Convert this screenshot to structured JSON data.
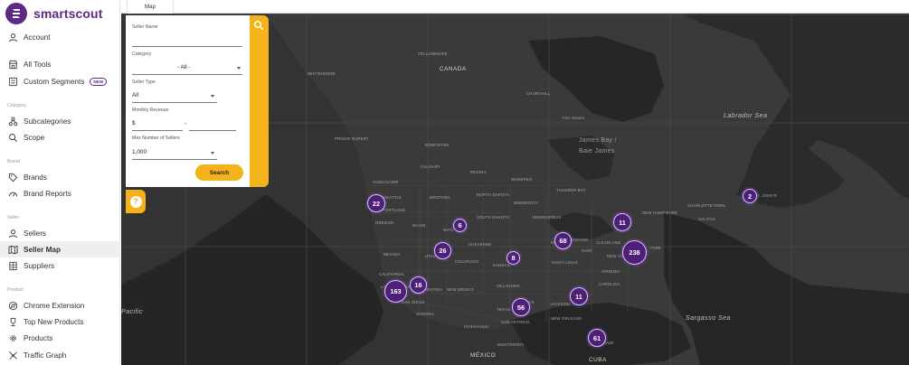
{
  "app": {
    "name": "smartscout",
    "brand_color": "#5b2a86",
    "accent_color": "#f4b21b"
  },
  "sidebar": {
    "account": {
      "label": "Account",
      "icon": "user-icon"
    },
    "all_tools": {
      "label": "All Tools",
      "icon": "store-icon"
    },
    "custom_segments": {
      "label": "Custom Segments",
      "badge": "NEW",
      "icon": "segments-icon"
    },
    "category_section": "Category",
    "subcategories": {
      "label": "Subcategories",
      "icon": "subcategories-icon"
    },
    "scope": {
      "label": "Scope",
      "icon": "scope-icon"
    },
    "brand_section": "Brand",
    "brands": {
      "label": "Brands",
      "icon": "tag-icon"
    },
    "brand_reports": {
      "label": "Brand Reports",
      "icon": "gauge-icon"
    },
    "seller_section": "Seller",
    "sellers": {
      "label": "Sellers",
      "icon": "user-icon"
    },
    "seller_map": {
      "label": "Seller Map",
      "icon": "map-icon",
      "active": true
    },
    "suppliers": {
      "label": "Suppliers",
      "icon": "building-icon"
    },
    "product_section": "Product",
    "chrome_extension": {
      "label": "Chrome Extension",
      "icon": "chrome-icon"
    },
    "top_new_products": {
      "label": "Top New Products",
      "icon": "trophy-icon"
    },
    "products": {
      "label": "Products",
      "icon": "gear-icon"
    },
    "traffic_graph": {
      "label": "Traffic Graph",
      "icon": "network-icon"
    }
  },
  "tabs": {
    "map": "Map"
  },
  "filter": {
    "seller_name_label": "Seller Name",
    "seller_name_value": "",
    "category_label": "Category",
    "category_value": "- All -",
    "seller_type_label": "Seller Type",
    "seller_type_value": "All",
    "monthly_revenue_label": "Monthly Revenue",
    "revenue_prefix": "$",
    "revenue_separator": "-",
    "max_sellers_label": "Max Number of Sellers",
    "max_sellers_value": "1,000",
    "search_label": "Search",
    "search_icon": "search-icon",
    "help_icon": "question-icon",
    "help_text": "?"
  },
  "map": {
    "countries": {
      "canada": "CANADA",
      "mexico": "MÉXICO",
      "cuba": "CUBA"
    },
    "seas": {
      "labrador": "Labrador Sea",
      "sargasso": "Sargasso Sea",
      "pacific": "Pacific"
    },
    "regions": {
      "james_bay": "James Bay /",
      "baie_james": "Baie James"
    },
    "places": {
      "whitehorse": "WHITEHORSE",
      "yellowknife": "YELLOWKNIFE",
      "churchill": "CHURCHILL",
      "fort_severn": "Fort Severn",
      "prince_rupert": "PRINCE RUPERT",
      "edmonton": "EDMONTON",
      "calgary": "CALGARY",
      "regina": "REGINA",
      "winnipeg": "WINNIPEG",
      "vancouver": "VANCOUVER",
      "seattle": "SEATTLE",
      "portland": "PORTLAND",
      "oregon": "OREGON",
      "idaho": "IDAHO",
      "montana": "MONTANA",
      "north_dakota": "NORTH DAKOTA",
      "south_dakota": "SOUTH DAKOTA",
      "minnesota": "MINNESOTA",
      "thunder_bay": "THUNDER BAY",
      "minneapolis": "MINNEAPOLIS",
      "wyoming": "WYO",
      "cheyenne": "CHEYENNE",
      "nevada": "NEVADA",
      "utah": "UTAH",
      "colorado": "COLORADO",
      "kansas": "KANSAS",
      "chicago": "CHICAGO",
      "detroit": "DETROIT",
      "ohio": "OHIO",
      "cleveland": "CLEVELAND",
      "new_york": "NEW YORK",
      "york": "YORK",
      "new_hampshire": "NEW HAMPSHIRE",
      "charlottetown": "CHARLOTTETOWN",
      "halifax": "HALIFAX",
      "st_johns": "ST. JOHN'S",
      "california": "CALIFORNIA",
      "los_angeles": "LOS ANGELES",
      "san_diego": "SAN DIEGO",
      "arizona": "ARIZONA",
      "new_mexico": "NEW MEXICO",
      "oklahoma": "OKLAHOMA",
      "st_louis": "SAINT LOUIS",
      "virginia": "VIRGINIA",
      "carolina": "CAROLINA",
      "texas": "TEXAS",
      "san_antonio": "SAN ANTONIO",
      "jackson": "JACKSON",
      "new_orleans": "NEW ORLEANS",
      "dallas": "DALLAS",
      "chihuahua": "CHIHUAHUA",
      "monterrey": "MONTERREY",
      "miami": "MIAMI",
      "sonora": "SONORA"
    },
    "clusters": [
      {
        "count": "22"
      },
      {
        "count": "6"
      },
      {
        "count": "26"
      },
      {
        "count": "8"
      },
      {
        "count": "68"
      },
      {
        "count": "11"
      },
      {
        "count": "238"
      },
      {
        "count": "2"
      },
      {
        "count": "163"
      },
      {
        "count": "16"
      },
      {
        "count": "56"
      },
      {
        "count": "11"
      },
      {
        "count": "61"
      }
    ]
  }
}
